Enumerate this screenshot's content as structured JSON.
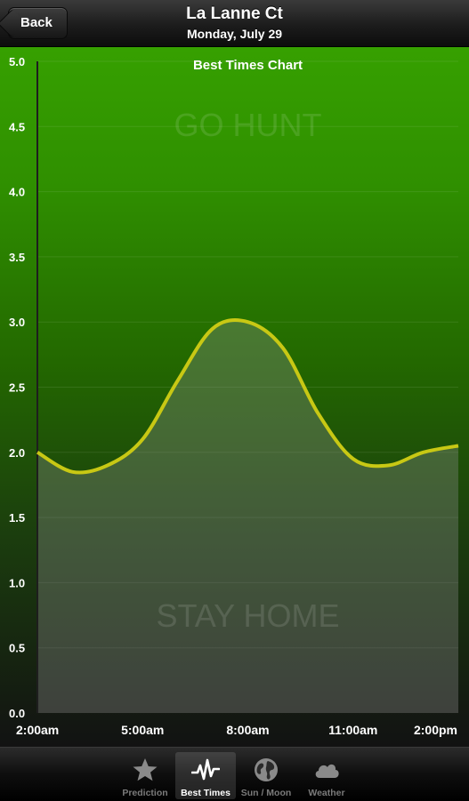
{
  "nav": {
    "back_label": "Back",
    "title": "La Lanne Ct",
    "subtitle": "Monday, July 29"
  },
  "chart_data": {
    "type": "area",
    "title": "Best Times Chart",
    "top_zone_label": "GO HUNT",
    "bottom_zone_label": "STAY HOME",
    "ylim": [
      0,
      5
    ],
    "y_ticks": [
      "0.0",
      "0.5",
      "1.0",
      "1.5",
      "2.0",
      "2.5",
      "3.0",
      "3.5",
      "4.0",
      "4.5",
      "5.0"
    ],
    "x_ticks": [
      "2:00am",
      "5:00am",
      "8:00am",
      "11:00am",
      "2:00pm"
    ],
    "x_tick_hours": [
      2,
      5,
      8,
      11,
      14
    ],
    "xlim_hours": [
      2,
      14
    ],
    "line_color": "#c8c814",
    "series": [
      {
        "x_hours": [
          2,
          3,
          4,
          5,
          6,
          7,
          8,
          9,
          10,
          11,
          12,
          13,
          14
        ],
        "values": [
          2.0,
          1.85,
          1.9,
          2.1,
          2.55,
          2.95,
          3.0,
          2.8,
          2.3,
          1.95,
          1.9,
          2.0,
          2.05
        ]
      }
    ]
  },
  "tabs": [
    {
      "label": "Prediction",
      "icon": "star-icon",
      "active": false
    },
    {
      "label": "Best Times",
      "icon": "pulse-icon",
      "active": true
    },
    {
      "label": "Sun / Moon",
      "icon": "globe-icon",
      "active": false
    },
    {
      "label": "Weather",
      "icon": "cloud-icon",
      "active": false
    }
  ]
}
